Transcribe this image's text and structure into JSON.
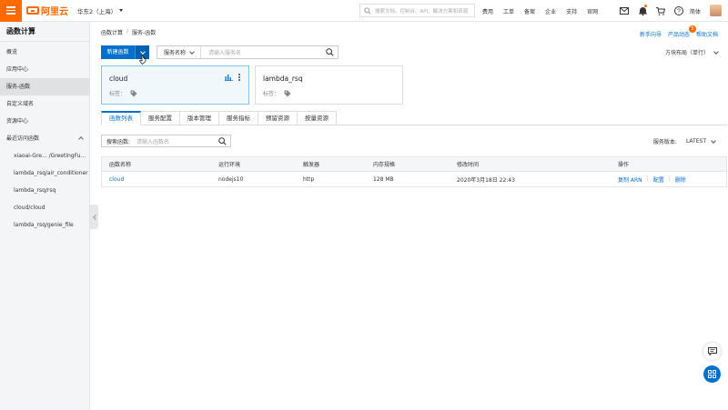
{
  "topbar": {
    "logo_text": "阿里云",
    "region": "华东2（上海）",
    "search_placeholder": "搜索文档、控制台、API、解决方案和资源",
    "links": [
      "费用",
      "工单",
      "备案",
      "企业",
      "支持",
      "官网"
    ],
    "language": "简体"
  },
  "sidebar": {
    "title": "函数计算",
    "items": [
      "概览",
      "应用中心",
      "服务-函数",
      "自定义域名",
      "资源中心"
    ],
    "active_index": 2,
    "recent_group": "最近访问函数",
    "recent": [
      "xiaoai-Gre... /GreetingFu...",
      "lambda_rsq/air_conditioner",
      "lambda_rsq/rsq",
      "cloud/cloud",
      "lambda_rsq/genie_file"
    ]
  },
  "breadcrumb": {
    "root": "函数计算",
    "sep": "/",
    "current": "服务-函数"
  },
  "header_links": {
    "guide": "新手向导",
    "news": "产品动态",
    "news_badge": "5",
    "docs": "帮助文档"
  },
  "toolbar": {
    "new_function": "新建函数",
    "service_select": "服务名称",
    "service_placeholder": "请输入服务名",
    "layout": "方块布局（单行）"
  },
  "services": [
    {
      "name": "cloud",
      "tag_label": "标签："
    },
    {
      "name": "lambda_rsq",
      "tag_label": "标签："
    }
  ],
  "tabs": [
    "函数列表",
    "服务配置",
    "版本管理",
    "服务指标",
    "预留资源",
    "按量资源"
  ],
  "function_search": {
    "label": "搜索函数:",
    "placeholder": "请输入函数名"
  },
  "version": {
    "label": "服务版本:",
    "value": "LATEST"
  },
  "table": {
    "headers": [
      "函数名称",
      "运行环境",
      "触发器",
      "内存规格",
      "修改时间",
      "操作"
    ],
    "rows": [
      {
        "name": "cloud",
        "runtime": "nodejs10",
        "trigger": "http",
        "memory": "128 MB",
        "modified": "2020年3月18日 22:43",
        "ops": [
          "复制 ARN",
          "配置",
          "删除"
        ]
      }
    ]
  },
  "colors": {
    "brand": "#ff6a00",
    "primary": "#0070cc"
  }
}
